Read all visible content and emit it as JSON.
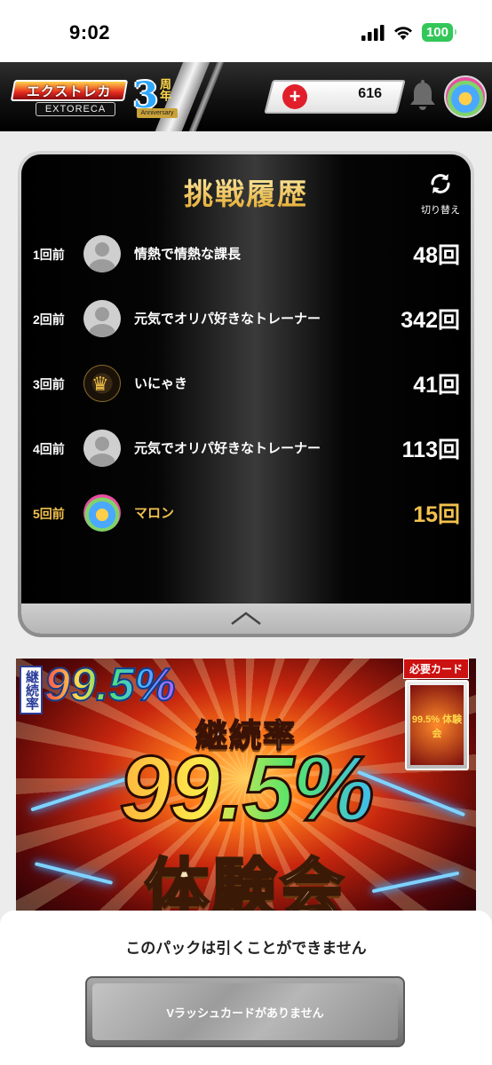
{
  "status_bar": {
    "time": "9:02",
    "battery": "100",
    "icons": [
      "cellular-signal-icon",
      "wifi-icon",
      "battery-icon"
    ]
  },
  "header": {
    "logo_main": "エクストレカ",
    "logo_sub": "EXTORECA",
    "logo_anniversary": "3",
    "logo_anniversary_kanji": "周年",
    "logo_anniversary_ribbon": "Anniversary",
    "coins": "616",
    "icons": [
      "plus-icon",
      "bell-icon",
      "user-avatar"
    ]
  },
  "history": {
    "title": "挑戦履歴",
    "switch_label": "切り替え",
    "rows": [
      {
        "label": "1回前",
        "name": "情熱で情熱な課長",
        "count": "48回",
        "avatar": "default"
      },
      {
        "label": "2回前",
        "name": "元気でオリパ好きなトレーナー",
        "count": "342回",
        "avatar": "default"
      },
      {
        "label": "3回前",
        "name": "いにゃき",
        "count": "41回",
        "avatar": "crown"
      },
      {
        "label": "4回前",
        "name": "元気でオリパ好きなトレーナー",
        "count": "113回",
        "avatar": "default"
      },
      {
        "label": "5回前",
        "name": "マロン",
        "count": "15回",
        "avatar": "mascot",
        "current": true
      }
    ],
    "colors": {
      "highlight": "#f3c14e",
      "text": "#ffffff"
    }
  },
  "banner": {
    "side_label": "継続率",
    "small_rate": "99.5%",
    "required_label": "必要カード",
    "card_text": "99.5% 体験会",
    "subtitle": "継続率",
    "main_rate": "99.5%",
    "event": "体験会"
  },
  "bottom_sheet": {
    "message": "このパックは引くことができません",
    "button_label": "Vラッシュカードがありません"
  }
}
